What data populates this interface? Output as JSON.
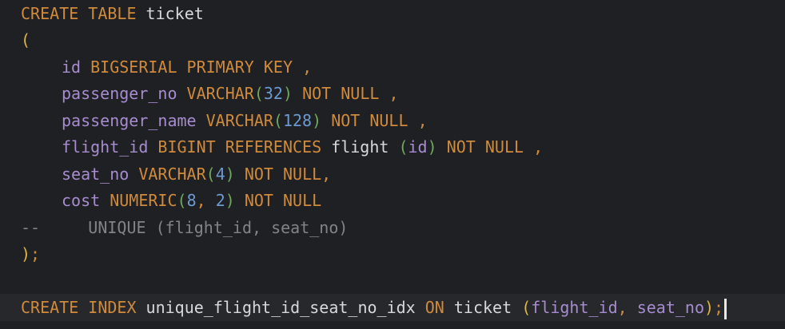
{
  "code": {
    "l1": {
      "kw": "CREATE TABLE",
      "name": "ticket"
    },
    "l2": {
      "open": "("
    },
    "l3": {
      "col": "id",
      "kw": "BIGSERIAL PRIMARY KEY",
      "comma": ","
    },
    "l4": {
      "col": "passenger_no",
      "type": "VARCHAR",
      "open": "(",
      "num": "32",
      "close": ")",
      "kw": "NOT NULL",
      "comma": ","
    },
    "l5": {
      "col": "passenger_name",
      "type": "VARCHAR",
      "open": "(",
      "num": "128",
      "close": ")",
      "kw": "NOT NULL",
      "comma": ","
    },
    "l6": {
      "col": "flight_id",
      "kw1": "BIGINT REFERENCES",
      "ref": "flight",
      "open": "(",
      "refcol": "id",
      "close": ")",
      "kw2": "NOT NULL",
      "comma": ","
    },
    "l7": {
      "col": "seat_no",
      "type": "VARCHAR",
      "open": "(",
      "num": "4",
      "close": ")",
      "kw": "NOT NULL",
      "comma": ","
    },
    "l8": {
      "col": "cost",
      "type": "NUMERIC",
      "open": "(",
      "num1": "8",
      "sep": ",",
      "num2": "2",
      "close": ")",
      "kw": "NOT NULL"
    },
    "l9": {
      "comment": "--     UNIQUE (flight_id, seat_no)"
    },
    "l10": {
      "close": ")",
      "semi": ";"
    },
    "l12": {
      "kw1": "CREATE INDEX",
      "name": "unique_flight_id_seat_no_idx",
      "kw2": "ON",
      "table": "ticket",
      "open": "(",
      "col1": "flight_id",
      "sep": ",",
      "col2": "seat_no",
      "close": ")",
      "semi": ";"
    }
  }
}
